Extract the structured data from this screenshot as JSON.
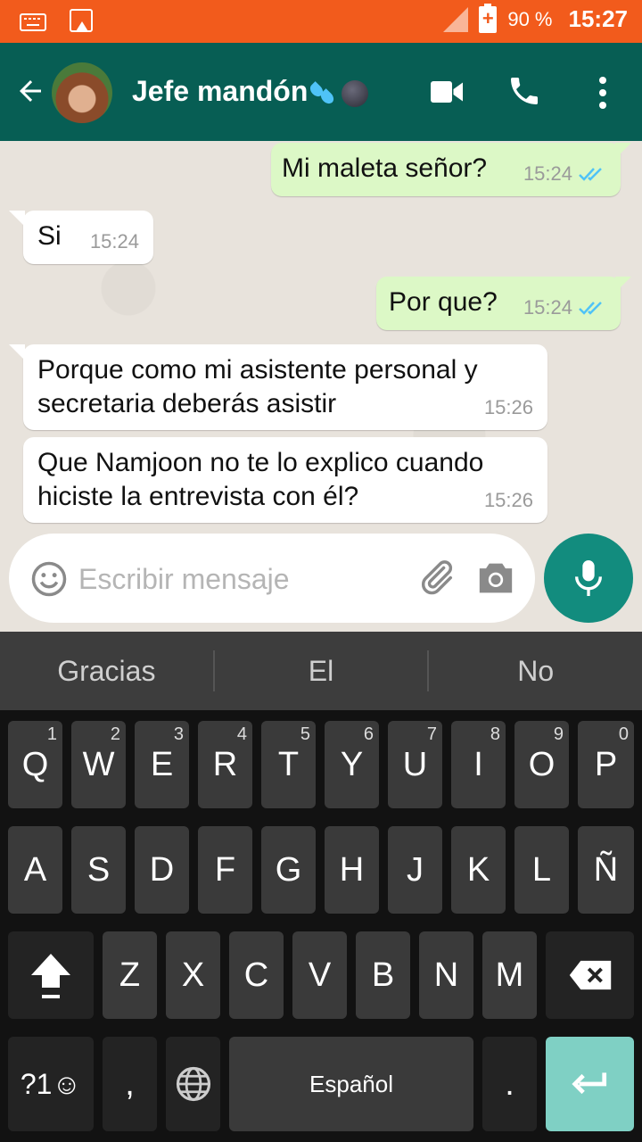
{
  "status_bar": {
    "battery_text": "90 %",
    "time": "15:27",
    "icons": [
      "keyboard-icon",
      "image-icon",
      "signal-icon",
      "battery-icon"
    ]
  },
  "header": {
    "contact_name": "Jefe mandón",
    "icons": [
      "back-arrow-icon",
      "avatar",
      "sweat-droplets-emoji",
      "new-moon-face-emoji",
      "video-call-icon",
      "phone-icon",
      "more-vert-icon"
    ]
  },
  "messages": [
    {
      "direction": "out",
      "text": "Mi maleta señor?",
      "time": "15:24",
      "status": "read"
    },
    {
      "direction": "in",
      "text": "Si",
      "time": "15:24"
    },
    {
      "direction": "out",
      "text": "Por que?",
      "time": "15:24",
      "status": "read"
    },
    {
      "direction": "in",
      "text_lines": [
        "Porque como mi asistente personal y",
        "secretaria deberás asistir"
      ],
      "time": "15:26"
    },
    {
      "direction": "in",
      "text_lines": [
        "Que Namjoon no te lo explico cuando",
        "hiciste la entrevista con él?"
      ],
      "time": "15:26"
    }
  ],
  "composer": {
    "placeholder": "Escribir mensaje",
    "value": ""
  },
  "suggestions": [
    "Gracias",
    "El",
    "No"
  ],
  "keyboard": {
    "row1": [
      {
        "label": "Q",
        "hint": "1"
      },
      {
        "label": "W",
        "hint": "2"
      },
      {
        "label": "E",
        "hint": "3"
      },
      {
        "label": "R",
        "hint": "4"
      },
      {
        "label": "T",
        "hint": "5"
      },
      {
        "label": "Y",
        "hint": "6"
      },
      {
        "label": "U",
        "hint": "7"
      },
      {
        "label": "I",
        "hint": "8"
      },
      {
        "label": "O",
        "hint": "9"
      },
      {
        "label": "P",
        "hint": "0"
      }
    ],
    "row2": [
      "A",
      "S",
      "D",
      "F",
      "G",
      "H",
      "J",
      "K",
      "L",
      "Ñ"
    ],
    "row3": [
      "Z",
      "X",
      "C",
      "V",
      "B",
      "N",
      "M"
    ],
    "symbols_label": "?1☺",
    "comma_label": ",",
    "space_label": "Español",
    "period_label": "."
  },
  "colors": {
    "status_bar": "#f25b1c",
    "header": "#075e54",
    "outgoing_bubble": "#dcf8c6",
    "incoming_bubble": "#ffffff",
    "read_ticks": "#4fc3f7",
    "mic_button": "#128c7e",
    "enter_key": "#7fd0c4"
  }
}
